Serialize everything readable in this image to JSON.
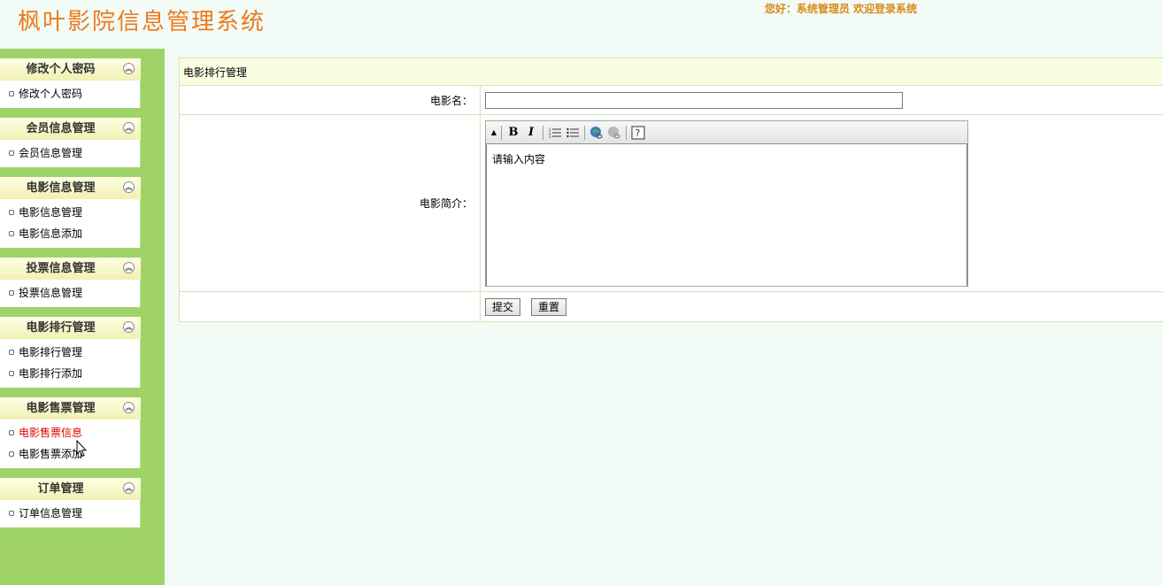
{
  "header": {
    "title": "枫叶影院信息管理系统",
    "greeting": "您好：系统管理员  欢迎登录系统"
  },
  "sidebar": {
    "groups": [
      {
        "title": "修改个人密码",
        "items": [
          "修改个人密码"
        ]
      },
      {
        "title": "会员信息管理",
        "items": [
          "会员信息管理"
        ]
      },
      {
        "title": "电影信息管理",
        "items": [
          "电影信息管理",
          "电影信息添加"
        ]
      },
      {
        "title": "投票信息管理",
        "items": [
          "投票信息管理"
        ]
      },
      {
        "title": "电影排行管理",
        "items": [
          "电影排行管理",
          "电影排行添加"
        ]
      },
      {
        "title": "电影售票管理",
        "items": [
          "电影售票信息",
          "电影售票添加"
        ]
      },
      {
        "title": "订单管理",
        "items": [
          "订单信息管理"
        ]
      }
    ],
    "active_item": "电影售票信息"
  },
  "form": {
    "title": "电影排行管理",
    "movie_name_label": "电影名：",
    "movie_name_value": "",
    "movie_intro_label": "电影简介：",
    "editor_content": "请输入内容",
    "submit_label": "提交",
    "reset_label": "重置"
  },
  "toolbar": {
    "bold": "B",
    "italic": "I"
  },
  "colors": {
    "title": "#ec7a1c",
    "sidebar_bg": "#9fd368",
    "page_bg": "#f2fbf6",
    "active_link": "#e30000"
  }
}
